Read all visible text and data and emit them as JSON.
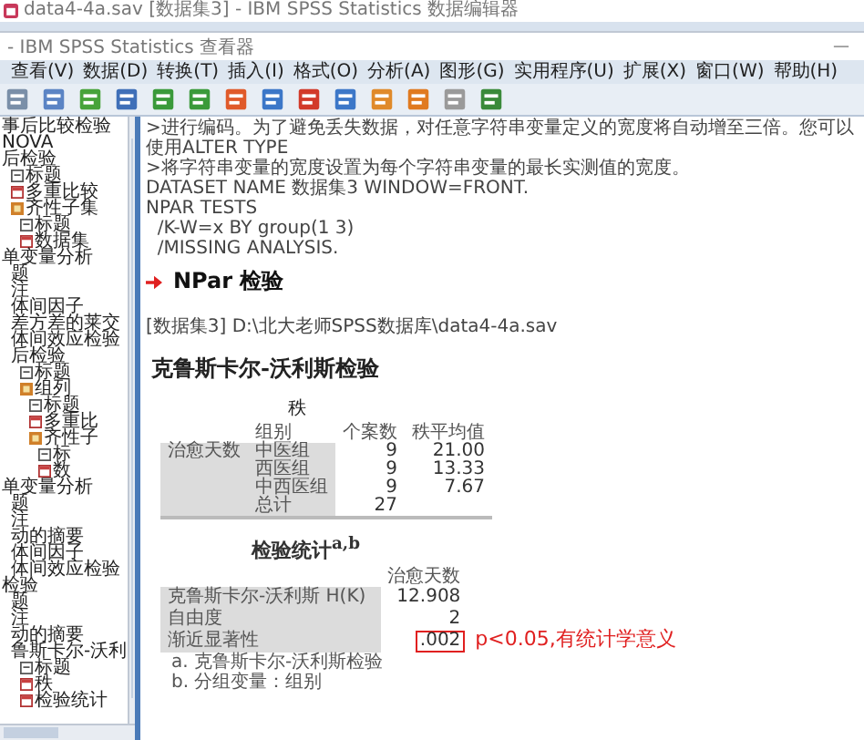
{
  "background_window": {
    "title": "data4-4a.sav [数据集3] - IBM SPSS Statistics 数据编辑器"
  },
  "window": {
    "title": "- IBM SPSS Statistics 查看器",
    "minimize": "—"
  },
  "menu": [
    "查看(V)",
    "数据(D)",
    "转换(T)",
    "插入(I)",
    "格式(O)",
    "分析(A)",
    "图形(G)",
    "实用程序(U)",
    "扩展(X)",
    "窗口(W)",
    "帮助(H)"
  ],
  "outline": [
    {
      "label": "事后比较检验"
    },
    {
      "label": "NOVA"
    },
    {
      "label": "后检验",
      "children": [
        {
          "label": "标题",
          "kind": "page"
        },
        {
          "label": "多重比较",
          "kind": "table"
        },
        {
          "label": "齐性子集",
          "kind": "book",
          "children": [
            {
              "label": "标题",
              "kind": "page"
            },
            {
              "label": "数据集",
              "kind": "table"
            }
          ]
        }
      ]
    },
    {
      "label": "单变量分析",
      "children": [
        {
          "label": "题"
        },
        {
          "label": "注"
        },
        {
          "label": "体间因子"
        },
        {
          "label": "差方差的莱交"
        },
        {
          "label": "体间效应检验"
        },
        {
          "label": "后检验",
          "children": [
            {
              "label": "标题",
              "kind": "page"
            },
            {
              "label": "组列",
              "kind": "book",
              "children": [
                {
                  "label": "标题",
                  "kind": "page"
                },
                {
                  "label": "多重比",
                  "kind": "table"
                },
                {
                  "label": "齐性子",
                  "kind": "book",
                  "children": [
                    {
                      "label": "标",
                      "kind": "page"
                    },
                    {
                      "label": "数",
                      "kind": "table"
                    }
                  ]
                }
              ]
            }
          ]
        }
      ]
    },
    {
      "label": "单变量分析",
      "children": [
        {
          "label": "题"
        },
        {
          "label": "注"
        },
        {
          "label": "动的摘要"
        },
        {
          "label": "体间因子"
        },
        {
          "label": "体间效应检验"
        }
      ]
    },
    {
      "label": "检验",
      "children": [
        {
          "label": "题"
        },
        {
          "label": "注"
        },
        {
          "label": "动的摘要"
        },
        {
          "label": "鲁斯卡尔-沃利",
          "children": [
            {
              "label": "标题",
              "kind": "page"
            },
            {
              "label": "秩",
              "kind": "table"
            },
            {
              "label": "检验统计",
              "kind": "table"
            }
          ]
        }
      ]
    }
  ],
  "log": [
    ">进行编码。为了避免丢失数据，对任意字符串变量定义的宽度将自动增至三倍。您可以使用ALTER TYPE",
    ">将字符串变量的宽度设置为每个字符串变量的最长实测值的宽度。",
    "DATASET NAME 数据集3 WINDOW=FRONT.",
    "NPAR TESTS",
    "  /K-W=x BY group(1 3)",
    "  /MISSING ANALYSIS."
  ],
  "npar": {
    "heading": "NPar 检验",
    "dataset": "[数据集3] D:\\北大老师SPSS数据库\\data4-4a.sav",
    "title": "克鲁斯卡尔-沃利斯检验",
    "ranks": {
      "title": "秩",
      "columns": [
        "组别",
        "个案数",
        "秩平均值"
      ],
      "row_label": "治愈天数",
      "rows": [
        {
          "group": "中医组",
          "n": "9",
          "mean": "21.00"
        },
        {
          "group": "西医组",
          "n": "9",
          "mean": "13.33"
        },
        {
          "group": "中西医组",
          "n": "9",
          "mean": "7.67"
        },
        {
          "group": "总计",
          "n": "27"
        }
      ]
    },
    "test_statistics": {
      "title": "检验统计$^{a,b}$",
      "column": "治愈天数",
      "rows": [
        {
          "label": "克鲁斯卡尔-沃利斯 H(K)",
          "value": "12.908",
          "highlighted": false
        },
        {
          "label": "自由度",
          "value": "2",
          "highlighted": false
        },
        {
          "label": "渐近显著性",
          "value": ".002",
          "highlighted": true
        }
      ],
      "footnotes": [
        "a. 克鲁斯卡尔-沃利斯检验",
        "b. 分组变量：组别"
      ]
    },
    "annotation": "p<0.05,有统计学意义"
  }
}
